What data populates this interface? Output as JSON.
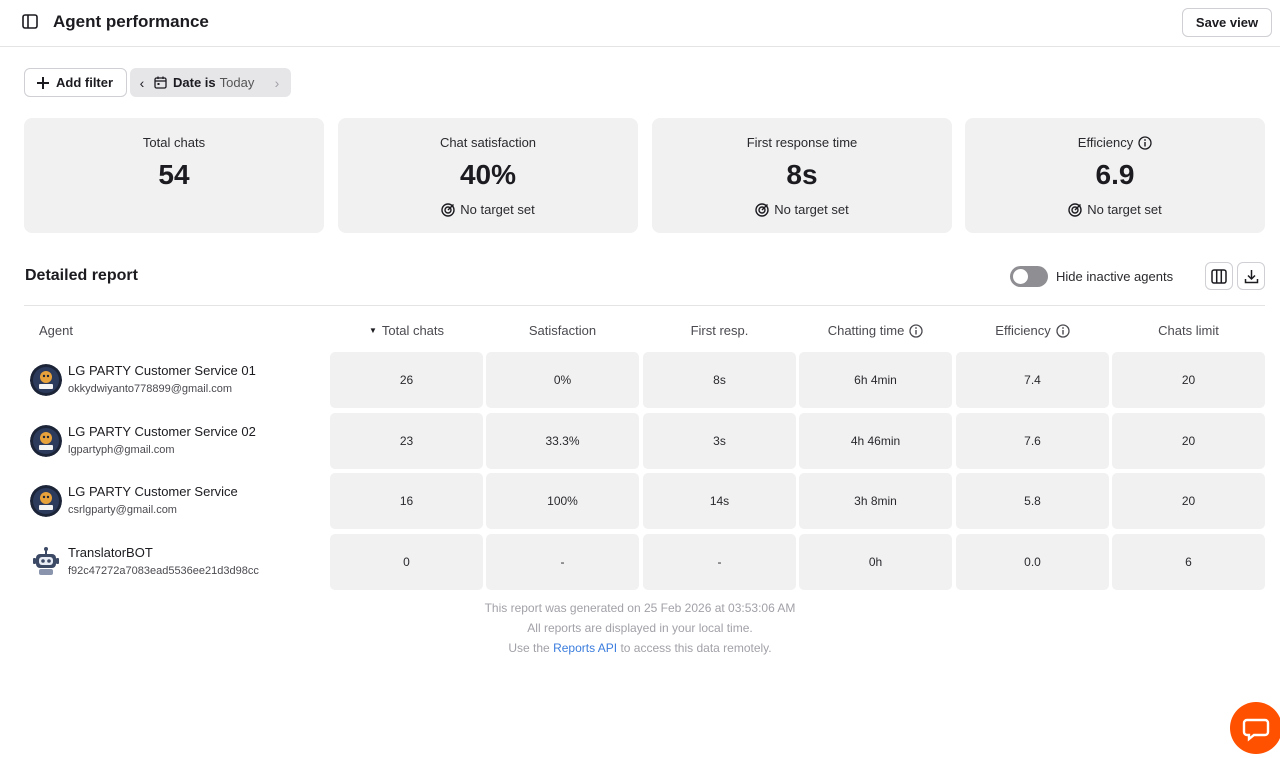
{
  "header": {
    "title": "Agent performance",
    "save_view_label": "Save view"
  },
  "filters": {
    "add_filter_label": "Add filter",
    "date_key": "Date is",
    "date_value": "Today"
  },
  "cards": [
    {
      "label": "Total chats",
      "value": "54",
      "target": ""
    },
    {
      "label": "Chat satisfaction",
      "value": "40%",
      "target": "No target set"
    },
    {
      "label": "First response time",
      "value": "8s",
      "target": "No target set"
    },
    {
      "label": "Efficiency",
      "value": "6.9",
      "target": "No target set"
    }
  ],
  "report": {
    "title": "Detailed report",
    "toggle_label": "Hide inactive agents",
    "toggle_on": false,
    "columns": [
      "Agent",
      "Total chats",
      "Satisfaction",
      "First resp.",
      "Chatting time",
      "Efficiency",
      "Chats limit"
    ],
    "rows": [
      {
        "name": "LG PARTY Customer Service 01",
        "email": "okkydwiyanto778899@gmail.com",
        "avatar": "lgparty-logo",
        "total_chats": "26",
        "satisfaction": "0%",
        "first_resp": "8s",
        "chatting_time": "6h 4min",
        "efficiency": "7.4",
        "chats_limit": "20"
      },
      {
        "name": "LG PARTY Customer Service 02",
        "email": "lgpartyph@gmail.com",
        "avatar": "lgparty-logo",
        "total_chats": "23",
        "satisfaction": "33.3%",
        "first_resp": "3s",
        "chatting_time": "4h 46min",
        "efficiency": "7.6",
        "chats_limit": "20"
      },
      {
        "name": "LG PARTY Customer Service",
        "email": "csrlgparty@gmail.com",
        "avatar": "lgparty-logo",
        "total_chats": "16",
        "satisfaction": "100%",
        "first_resp": "14s",
        "chatting_time": "3h 8min",
        "efficiency": "5.8",
        "chats_limit": "20"
      },
      {
        "name": "TranslatorBOT",
        "email": "f92c47272a7083ead5536ee21d3d98cc",
        "avatar": "robot-icon",
        "total_chats": "0",
        "satisfaction": "-",
        "first_resp": "-",
        "chatting_time": "0h",
        "efficiency": "0.0",
        "chats_limit": "6"
      }
    ]
  },
  "footer": {
    "generated": "This report was generated on 25 Feb 2026 at 03:53:06 AM",
    "local_time": "All reports are displayed in your local time.",
    "use_prefix": "Use the",
    "api_link": "Reports API",
    "use_suffix": "to access this data remotely."
  },
  "colors": {
    "accent": "#ff5100",
    "link": "#3b7ddd",
    "card_bg": "#f1f1f2"
  }
}
